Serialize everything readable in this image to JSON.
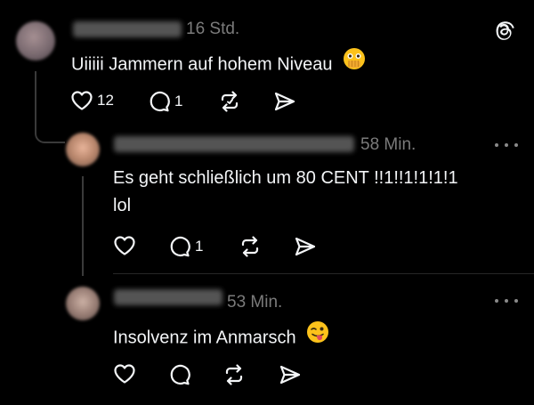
{
  "app": {
    "logo_icon": "threads-logo-icon",
    "accent": "#f3f5f7",
    "background": "#000000"
  },
  "posts": [
    {
      "time": "16 Std.",
      "text": "Uiiiii Jammern auf hohem Niveau",
      "emoji_icon": "face-with-open-eyes-and-hand-over-mouth-emoji",
      "likes": "12",
      "replies": "1"
    },
    {
      "time": "58 Min.",
      "text_line1": "Es geht schließlich um 80 CENT !!1!!1!1!1!1",
      "text_line2": "lol",
      "replies": "1"
    },
    {
      "time": "53 Min.",
      "text": "Insolvenz im Anmarsch",
      "emoji_icon": "winking-face-with-tongue-emoji"
    }
  ]
}
